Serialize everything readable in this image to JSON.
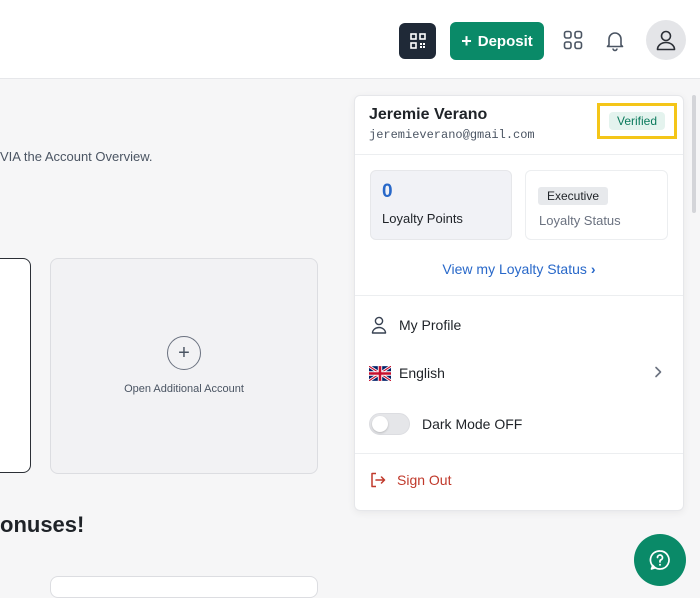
{
  "header": {
    "deposit_label": "Deposit",
    "qr_icon": "qr-code-icon",
    "apps_icon": "apps-grid-icon",
    "bell_icon": "bell-icon",
    "avatar_icon": "user-icon"
  },
  "page": {
    "overview_text": "VIA the Account Overview.",
    "add_account_label": "Open Additional Account",
    "bonuses_heading": "onuses!"
  },
  "panel": {
    "user_name": "Jeremie Verano",
    "user_email": "jeremieverano@gmail.com",
    "verified_label": "Verified",
    "loyalty_points_value": "0",
    "loyalty_points_label": "Loyalty Points",
    "loyalty_status_value": "Executive",
    "loyalty_status_label": "Loyalty Status",
    "loyalty_link": "View my Loyalty Status",
    "menu": {
      "profile": "My Profile",
      "language": "English",
      "dark_mode": "Dark Mode OFF",
      "sign_out": "Sign Out"
    }
  },
  "colors": {
    "accent": "#0a8a68",
    "link": "#2868c9",
    "highlight": "#f4c518",
    "danger": "#c0392b"
  }
}
